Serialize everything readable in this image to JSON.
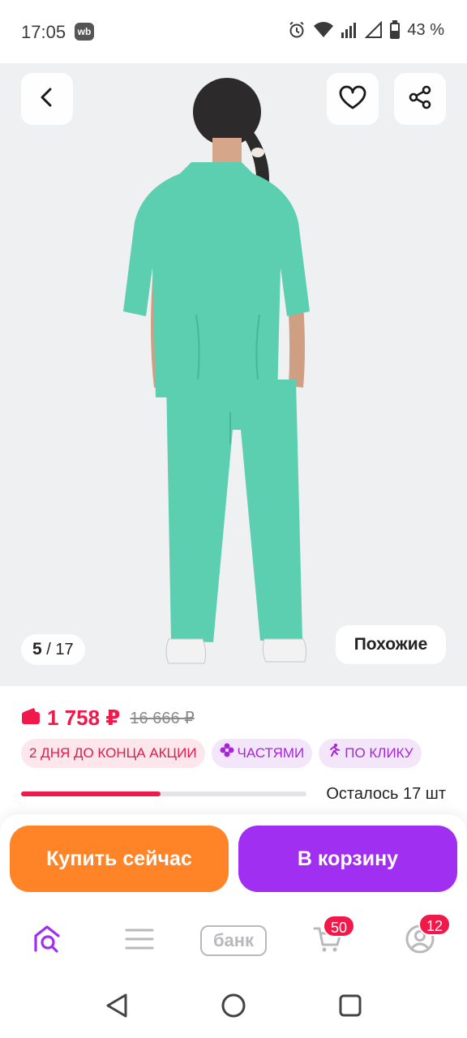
{
  "status_bar": {
    "time": "17:05",
    "app_badge": "wb",
    "battery": "43 %",
    "icons": [
      "alarm-icon",
      "wifi-icon",
      "signal-icon",
      "signal-empty-icon",
      "battery-icon"
    ]
  },
  "gallery": {
    "current": "5",
    "separator": "/",
    "total": "17",
    "similar_label": "Похожие",
    "icons": {
      "back": "chevron-left-icon",
      "favorite": "heart-icon",
      "share": "share-icon"
    }
  },
  "product": {
    "price_current": "1 758 ₽",
    "price_old": "16 666 ₽",
    "wallet_icon": "wallet-icon",
    "promo_badges": [
      {
        "label": "2 ДНЯ ДО КОНЦА АКЦИИ",
        "style": "red"
      },
      {
        "label": "ЧАСТЯМИ",
        "style": "violet",
        "icon": "flower-icon"
      },
      {
        "label": "ПО КЛИКУ",
        "style": "violet",
        "icon": "running-man-icon"
      }
    ],
    "stock_text": "Осталось 17 шт",
    "stock_fill_fraction": 0.49
  },
  "actions": {
    "buy_now": "Купить сейчас",
    "add_to_cart": "В корзину"
  },
  "bottom_nav": {
    "bank_label": "банк",
    "basket_badge": "50",
    "profile_badge": "12",
    "accent_color": "#a02ff1"
  },
  "colors": {
    "price": "#f1184a",
    "buy_button": "#ff8327",
    "cart_button": "#a02ff1",
    "scrubs": "#5bcfb0"
  }
}
